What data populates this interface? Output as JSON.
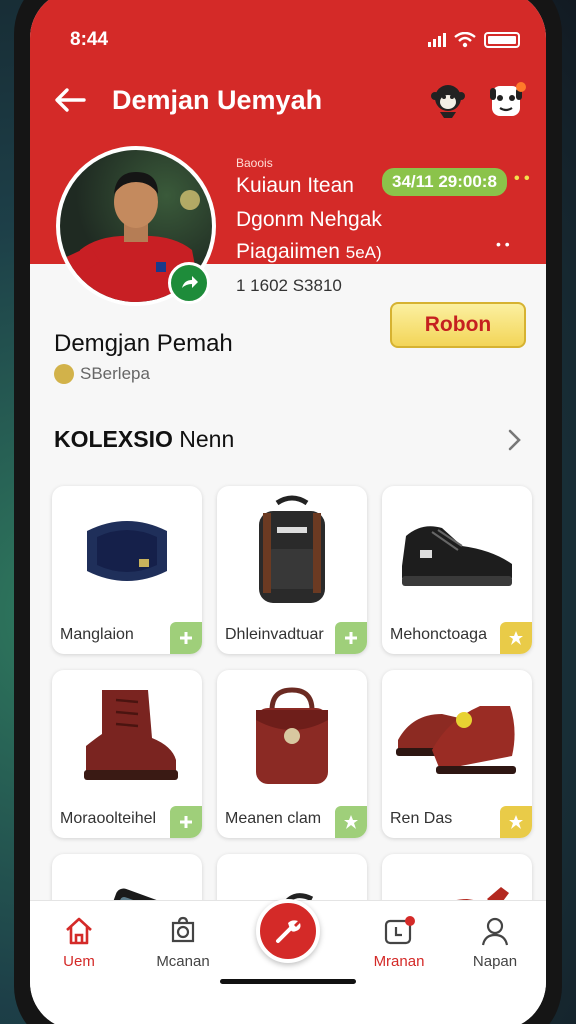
{
  "status": {
    "time": "8:44"
  },
  "header": {
    "title": "Demjan Uemyah"
  },
  "profile": {
    "small_label": "Baoois",
    "line1": "Kuiaun Itean",
    "line2": "Dgonm Nehgak",
    "line3": "Piagaiimen",
    "line3_suffix": "5eA)",
    "date_pill": "34/11 29:00:8",
    "pill_dots": "• •",
    "side_mark": "• •",
    "id_text": "1 1602 S3810",
    "name": "Demgjan Pemah",
    "sub_text": "SBerlepa",
    "action_label": "Robon"
  },
  "collection": {
    "title_bold": "KOLEXSIO",
    "title_rest": " Nenn"
  },
  "items": [
    {
      "label": "Manglaion",
      "accent": "green"
    },
    {
      "label": "Dhleinvadtuar",
      "accent": "green"
    },
    {
      "label": "Mehonctoaga",
      "accent": "gold"
    },
    {
      "label": "Moraoolteihel",
      "accent": "green"
    },
    {
      "label": "Meanen clam",
      "accent": "green"
    },
    {
      "label": "Ren Das",
      "accent": "gold"
    }
  ],
  "tabs": [
    {
      "label": "Uem",
      "active": true
    },
    {
      "label": "Mcanan",
      "active": false
    },
    {
      "label": "Mranan",
      "active": true
    },
    {
      "label": "Napan",
      "active": false
    }
  ],
  "colors": {
    "brand_red": "#d42a28",
    "accent_green": "#9fcf7a",
    "accent_gold": "#e9cb48"
  }
}
